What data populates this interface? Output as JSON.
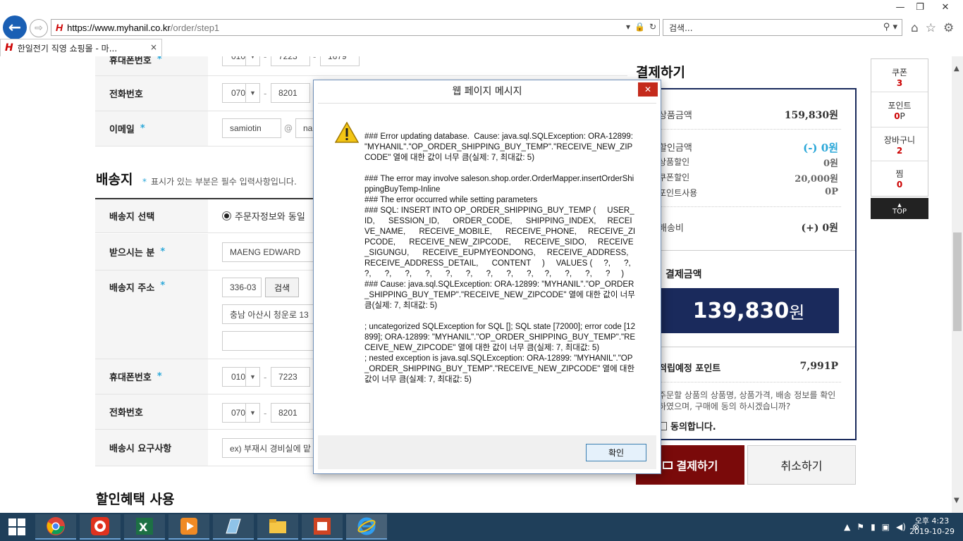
{
  "browser": {
    "url_host": "https://www.myhanil.co.kr",
    "url_path": "/order/step1",
    "search_placeholder": "검색...",
    "tab_title": "한일전기 직영 쇼핑몰 - 마...",
    "tab_close": "×",
    "logo_text": "H",
    "window_minimize": "—",
    "window_restore": "❐",
    "window_close": "✕",
    "back": "←",
    "forward": "⇨",
    "refresh": "↻",
    "lock": "🔒",
    "home": "⌂",
    "star": "☆",
    "gear": "⚙",
    "search_icon": "⚲"
  },
  "orderer": {
    "mobile_label": "휴대폰번호",
    "mobile_p1": "010",
    "mobile_p2": "7223",
    "mobile_p3": "1679",
    "phone_label": "전화번호",
    "phone_p1": "070",
    "phone_p2": "8201",
    "email_label": "이메일",
    "email_id": "samiotin",
    "email_at": "@",
    "email_domain": "na"
  },
  "shipping": {
    "heading": "배송지",
    "required_note": "표시가 있는 부분은 필수 입력사항입니다.",
    "select_label": "배송지 선택",
    "select_option": "주문자정보와 동일",
    "receiver_label": "받으시는 분",
    "receiver_value": "MAENG EDWARD",
    "address_label": "배송지 주소",
    "zipcode_value": "336-03",
    "search_button": "검색",
    "address1_value": "충남 아산시 청운로 13",
    "mobile_label": "휴대폰번호",
    "mobile_p1": "010",
    "mobile_p2": "7223",
    "phone_label": "전화번호",
    "phone_p1": "070",
    "phone_p2": "8201",
    "request_label": "배송시 요구사항",
    "request_placeholder": "ex) 부재시 경비실에 맡"
  },
  "discount_heading": "할인혜택 사용",
  "summary": {
    "title": "결제하기",
    "product_amount_label": "상품금액",
    "product_amount": "159,830원",
    "discount_label": "할인금액",
    "discount_amount": "(-) 0원",
    "product_discount_label": "상품할인",
    "product_discount": "0원",
    "coupon_discount_label": "쿠폰할인",
    "coupon_discount": "20,000원",
    "point_use_label": "포인트사용",
    "point_use": "0P",
    "shipping_label": "배송비",
    "shipping_amount": "(+) 0원",
    "total_label": "결제금액",
    "total_amount": "139,830",
    "total_unit": "원",
    "earn_label": "적립예정 포인트",
    "earn_points": "7,991P",
    "agree_text": "주문할 상품의 상품명, 상품가격, 배송 정보를 확인하였으며, 구매에 동의 하시겠습니까?",
    "agree_label": "동의합니다.",
    "pay_button": "결제하기",
    "cancel_button": "취소하기"
  },
  "quick_menu": {
    "coupon_label": "쿠폰",
    "coupon_count": "3",
    "point_label": "포인트",
    "point_value": "0",
    "point_unit": "P",
    "cart_label": "장바구니",
    "cart_count": "2",
    "wish_label": "찜",
    "wish_count": "0",
    "top_label": "TOP",
    "top_arrow": "▲"
  },
  "dialog": {
    "title": "웹 페이지 메시지",
    "message": "### Error updating database.  Cause: java.sql.SQLException: ORA-12899: \"MYHANIL\".\"OP_ORDER_SHIPPING_BUY_TEMP\".\"RECEIVE_NEW_ZIPCODE\" 열에 대한 값이 너무 큼(실제: 7, 최대값: 5)\n\n### The error may involve saleson.shop.order.OrderMapper.insertOrderShippingBuyTemp-Inline\n### The error occurred while setting parameters\n### SQL: INSERT INTO OP_ORDER_SHIPPING_BUY_TEMP (     USER_ID,      SESSION_ID,      ORDER_CODE,      SHIPPING_INDEX,     RECEIVE_NAME,      RECEIVE_MOBILE,      RECEIVE_PHONE,     RECEIVE_ZIPCODE,      RECEIVE_NEW_ZIPCODE,      RECEIVE_SIDO,     RECEIVE_SIGUNGU,      RECEIVE_EUPMYEONDONG,     RECEIVE_ADDRESS,      RECEIVE_ADDRESS_DETAIL,      CONTENT     )     VALUES (     ?,      ?,      ?,      ?,      ?,      ?,      ?,      ?,      ?,      ?,      ?,     ?,      ?,      ?,      ?     )\n### Cause: java.sql.SQLException: ORA-12899: \"MYHANIL\".\"OP_ORDER_SHIPPING_BUY_TEMP\".\"RECEIVE_NEW_ZIPCODE\" 열에 대한 값이 너무 큼(실제: 7, 최대값: 5)\n\n; uncategorized SQLException for SQL []; SQL state [72000]; error code [12899]; ORA-12899: \"MYHANIL\".\"OP_ORDER_SHIPPING_BUY_TEMP\".\"RECEIVE_NEW_ZIPCODE\" 열에 대한 값이 너무 큼(실제: 7, 최대값: 5)\n; nested exception is java.sql.SQLException: ORA-12899: \"MYHANIL\".\"OP_ORDER_SHIPPING_BUY_TEMP\".\"RECEIVE_NEW_ZIPCODE\" 열에 대한 값이 너무 큼(실제: 7, 최대값: 5)",
    "ok_button": "확인",
    "close": "✕"
  },
  "taskbar": {
    "time": "오후 4:23",
    "date": "2019-10-29"
  },
  "colors": {
    "navy": "#1a2a5c",
    "accent_blue": "#2aa7d8",
    "pay_red": "#7a0a0a",
    "brand_red": "#cc0000",
    "taskbar": "#1f3f5a"
  }
}
